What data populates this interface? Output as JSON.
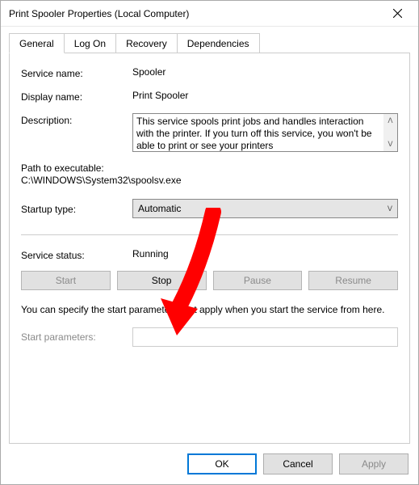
{
  "window": {
    "title": "Print Spooler Properties (Local Computer)"
  },
  "tabs": {
    "general": "General",
    "logon": "Log On",
    "recovery": "Recovery",
    "dependencies": "Dependencies"
  },
  "labels": {
    "service_name": "Service name:",
    "display_name": "Display name:",
    "description": "Description:",
    "path": "Path to executable:",
    "startup_type": "Startup type:",
    "service_status": "Service status:",
    "start_params": "Start parameters:"
  },
  "values": {
    "service_name": "Spooler",
    "display_name": "Print Spooler",
    "description": "This service spools print jobs and handles interaction with the printer.  If you turn off this service, you won't be able to print or see your printers",
    "path": "C:\\WINDOWS\\System32\\spoolsv.exe",
    "startup_type": "Automatic",
    "service_status": "Running",
    "start_params": ""
  },
  "buttons": {
    "start": "Start",
    "stop": "Stop",
    "pause": "Pause",
    "resume": "Resume",
    "ok": "OK",
    "cancel": "Cancel",
    "apply": "Apply"
  },
  "info_text": "You can specify the start parameters that apply when you start the service from here."
}
